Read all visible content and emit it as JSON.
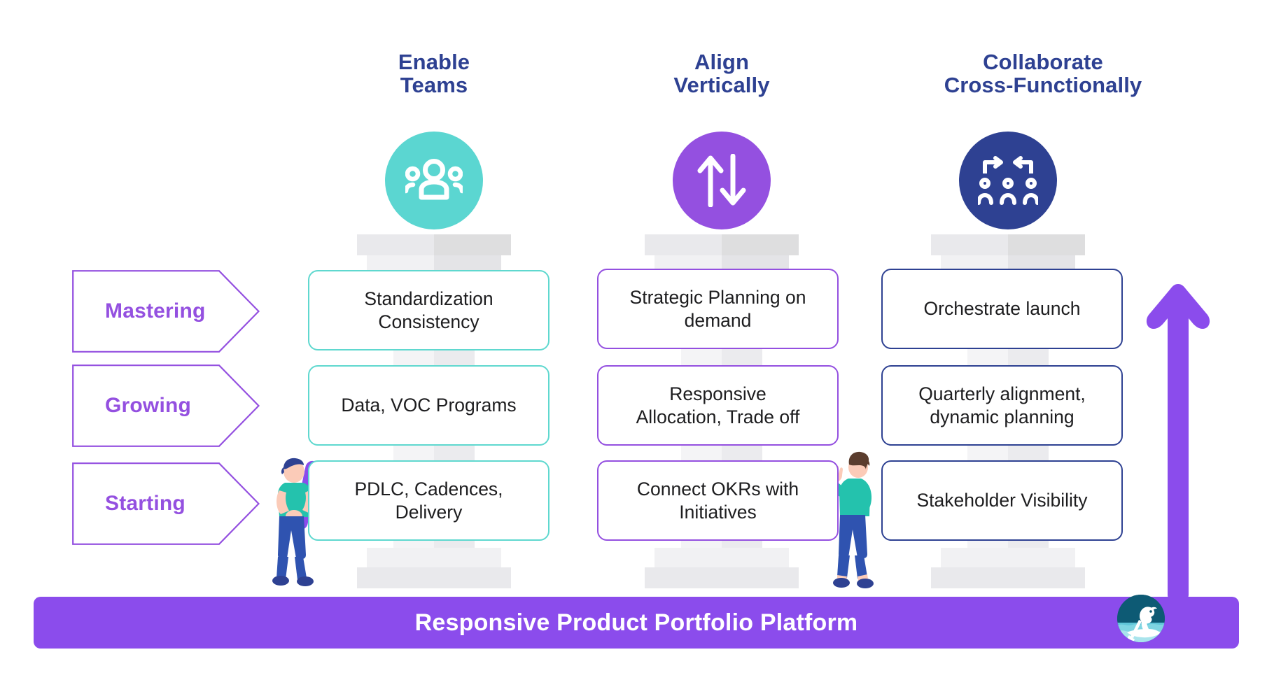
{
  "columns": [
    {
      "heading_line1": "Enable",
      "heading_line2": "Teams",
      "icon": "people-group-icon",
      "icon_color": "#5bd6d1",
      "accent": "#5fd8cf",
      "cards": [
        "Standardization\nConsistency",
        "Data, VOC Programs",
        "PDLC, Cadences,\nDelivery"
      ]
    },
    {
      "heading_line1": "Align",
      "heading_line2": "Vertically",
      "icon": "up-down-arrows-icon",
      "icon_color": "#9450e0",
      "accent": "#9450e0",
      "cards": [
        "Strategic Planning on\ndemand",
        "Responsive\nAllocation, Trade off",
        "Connect OKRs with\nInitiatives"
      ]
    },
    {
      "heading_line1": "Collaborate",
      "heading_line2": "Cross-Functionally",
      "icon": "collaboration-network-icon",
      "icon_color": "#2e4192",
      "accent": "#2e4192",
      "cards": [
        "Orchestrate launch",
        "Quarterly alignment,\ndynamic planning",
        "Stakeholder Visibility"
      ]
    }
  ],
  "maturity_levels": [
    {
      "label": "Mastering"
    },
    {
      "label": "Growing"
    },
    {
      "label": "Starting"
    }
  ],
  "footer": {
    "title": "Responsive Product Portfolio Platform",
    "bar_color": "#8b4cec",
    "logo": "dragon-boat-logo"
  },
  "growth_arrow": {
    "name": "upward-growth-arrow",
    "color": "#8b4cec"
  },
  "illustrations": [
    {
      "name": "person-holding-roll-illustration"
    },
    {
      "name": "person-pointing-illustration"
    }
  ],
  "theme": {
    "heading_color": "#2e4192",
    "level_label_color": "#9450e0",
    "card_text_color": "#1d1d1f",
    "pillar_color": "#f1f1f3",
    "background": "#ffffff"
  }
}
